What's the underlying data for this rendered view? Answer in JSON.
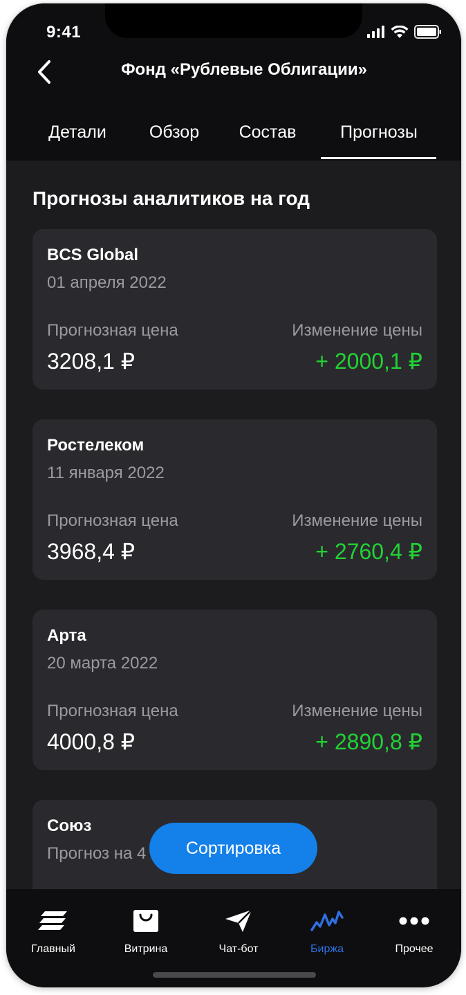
{
  "status_bar": {
    "time": "9:41"
  },
  "header": {
    "title": "Фонд «Рублевые Облигации»",
    "tabs": [
      "Детали",
      "Обзор",
      "Состав",
      "Прогнозы"
    ],
    "active_tab": "Прогнозы"
  },
  "section": {
    "title": "Прогнозы аналитиков на год"
  },
  "cards": [
    {
      "name": "BCS Global",
      "date": "01 апреля 2022",
      "price_label": "Прогнозная цена",
      "price": "3208,1 ₽",
      "change_label": "Изменение цены",
      "change": "+ 2000,1 ₽"
    },
    {
      "name": "Ростелеком",
      "date": "11 января 2022",
      "price_label": "Прогнозная цена",
      "price": "3968,4 ₽",
      "change_label": "Изменение цены",
      "change": "+ 2760,4 ₽"
    },
    {
      "name": "Арта",
      "date": "20 марта 2022",
      "price_label": "Прогнозная цена",
      "price": "4000,8 ₽",
      "change_label": "Изменение цены",
      "change": "+ 2890,8 ₽"
    },
    {
      "name": "Союз",
      "date": "Прогноз на 4",
      "price_label": "",
      "price": "",
      "change_label": "",
      "change": ""
    }
  ],
  "sort_button": {
    "label": "Сортировка"
  },
  "bottom_nav": {
    "items": [
      {
        "label": "Главный",
        "icon": "stack-icon"
      },
      {
        "label": "Витрина",
        "icon": "shopping-bag-icon"
      },
      {
        "label": "Чат-бот",
        "icon": "paper-plane-icon"
      },
      {
        "label": "Биржа",
        "icon": "chart-wave-icon"
      },
      {
        "label": "Прочее",
        "icon": "more-dots-icon"
      }
    ],
    "active": "Биржа"
  },
  "colors": {
    "background": "#1c1c1e",
    "card": "#2a2a2e",
    "positive": "#22d234",
    "accent": "#1480ea",
    "nav_active": "#2f6fe0"
  }
}
